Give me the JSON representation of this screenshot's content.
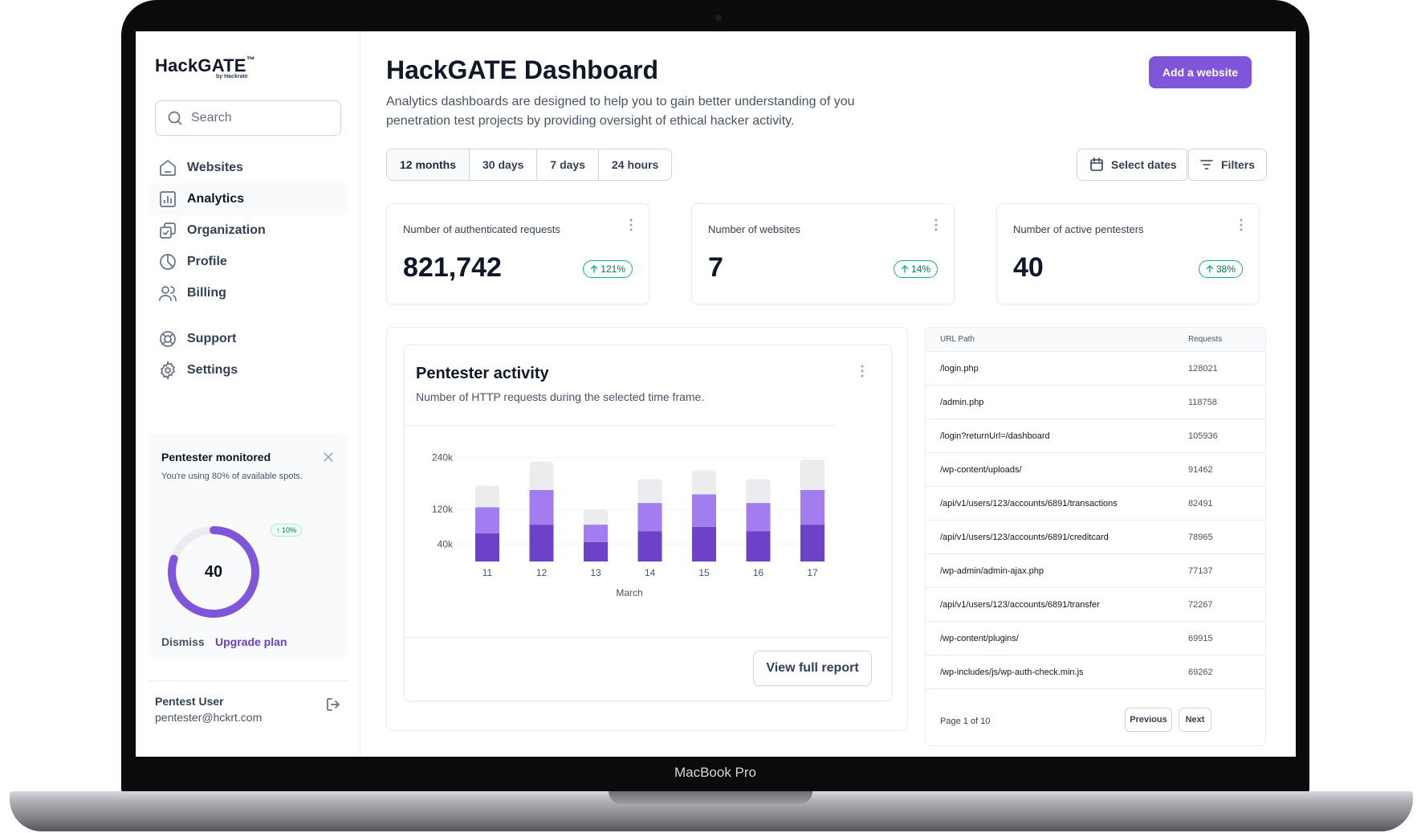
{
  "device": {
    "label": "MacBook Pro"
  },
  "sidebar": {
    "logo": "HackGATE",
    "logo_mark": "™",
    "logo_sub": "by Hackrate",
    "search_placeholder": "Search",
    "nav": [
      {
        "label": "Websites",
        "icon": "home-icon"
      },
      {
        "label": "Analytics",
        "icon": "bar-chart-icon",
        "active": true
      },
      {
        "label": "Organization",
        "icon": "organization-icon"
      },
      {
        "label": "Profile",
        "icon": "pie-chart-icon"
      },
      {
        "label": "Billing",
        "icon": "users-icon"
      }
    ],
    "secondary_nav": [
      {
        "label": "Support",
        "icon": "life-buoy-icon"
      },
      {
        "label": "Settings",
        "icon": "gear-icon"
      }
    ],
    "promo": {
      "title": "Pentester monitored",
      "subtitle": "You're using 80% of available spots.",
      "value": "40",
      "usage_fraction": 0.8,
      "badge": "10%",
      "dismiss": "Dismiss",
      "upgrade": "Upgrade plan"
    },
    "user": {
      "name": "Pentest User",
      "email": "pentester@hckrt.com"
    }
  },
  "header": {
    "title": "HackGATE Dashboard",
    "description": "Analytics dashboards are designed to help you to gain better understanding of you penetration test projects by providing oversight of ethical hacker activity.",
    "add_button": "Add a website"
  },
  "filters": {
    "ranges": [
      "12 months",
      "30 days",
      "7 days",
      "24 hours"
    ],
    "active_range": 0,
    "select_dates": "Select dates",
    "filters": "Filters"
  },
  "stats": [
    {
      "label": "Number of authenticated requests",
      "value": "821,742",
      "change": "121%"
    },
    {
      "label": "Number of websites",
      "value": "7",
      "change": "14%"
    },
    {
      "label": "Number of active pentesters",
      "value": "40",
      "change": "38%"
    }
  ],
  "chart": {
    "title": "Pentester activity",
    "subtitle": "Number of HTTP requests during the selected time frame.",
    "button": "View full report",
    "colors": {
      "dark": "#6e42c8",
      "mid": "#a27df0",
      "light": "#ececee"
    }
  },
  "chart_data": {
    "type": "bar",
    "stacked": true,
    "categories": [
      "11",
      "12",
      "13",
      "14",
      "15",
      "16",
      "17"
    ],
    "xlabel": "March",
    "ylabel": "",
    "yticks": [
      "40k",
      "120k",
      "240k"
    ],
    "ytick_values": [
      40000,
      120000,
      240000
    ],
    "ylim": [
      0,
      250000
    ],
    "series": [
      {
        "values": [
          65000,
          85000,
          45000,
          70000,
          80000,
          70000,
          85000
        ]
      },
      {
        "values": [
          60000,
          80000,
          40000,
          65000,
          75000,
          65000,
          80000
        ]
      },
      {
        "values": [
          50000,
          65000,
          35000,
          55000,
          55000,
          55000,
          70000
        ]
      }
    ]
  },
  "table": {
    "columns": [
      "URL Path",
      "Requests"
    ],
    "rows": [
      [
        "/login.php",
        "128021"
      ],
      [
        "/admin.php",
        "118758"
      ],
      [
        "/login?returnUrl=/dashboard",
        "105936"
      ],
      [
        "/wp-content/uploads/",
        "91462"
      ],
      [
        "/api/v1/users/123/accounts/6891/transactions",
        "82491"
      ],
      [
        "/api/v1/users/123/accounts/6891/creditcard",
        "78965"
      ],
      [
        "/wp-admin/admin-ajax.php",
        "77137"
      ],
      [
        "/api/v1/users/123/accounts/6891/transfer",
        "72267"
      ],
      [
        "/wp-content/plugins/",
        "69915"
      ],
      [
        "/wp-includes/js/wp-auth-check.min.js",
        "69262"
      ]
    ],
    "page_info": "Page 1 of 10",
    "previous": "Previous",
    "next": "Next"
  }
}
